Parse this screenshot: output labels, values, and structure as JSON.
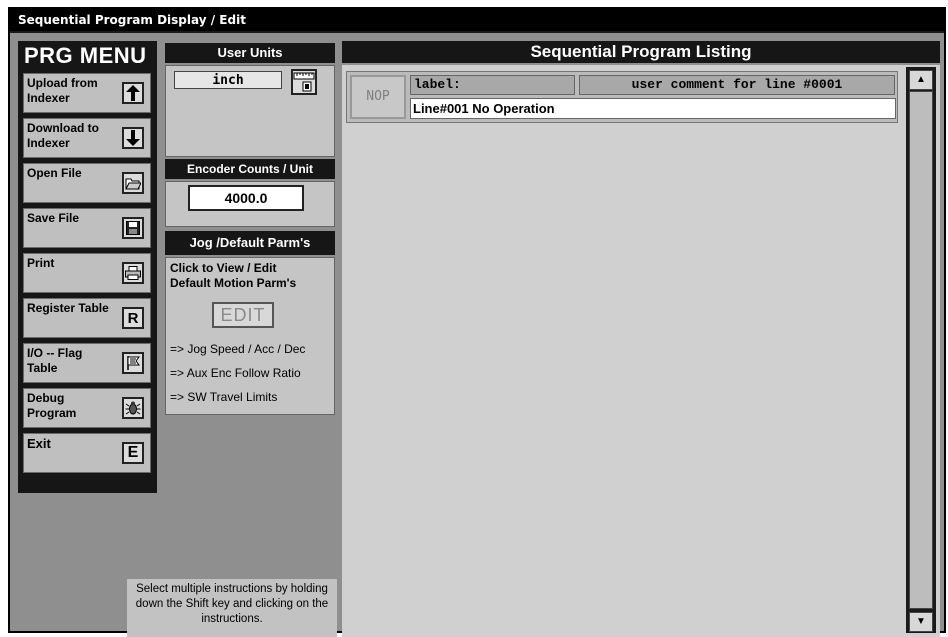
{
  "window": {
    "title": "Sequential Program Display / Edit"
  },
  "menu": {
    "title": "PRG MENU",
    "items": [
      {
        "label": "Upload from Indexer",
        "icon": "arrow-up-icon",
        "glyph": "🡅"
      },
      {
        "label": "Download to Indexer",
        "icon": "arrow-down-icon",
        "glyph": "🡇"
      },
      {
        "label": "Open File",
        "icon": "open-folder-icon",
        "glyph": ""
      },
      {
        "label": "Save File",
        "icon": "floppy-disk-icon",
        "glyph": ""
      },
      {
        "label": "Print",
        "icon": "printer-icon",
        "glyph": ""
      },
      {
        "label": "Register Table",
        "icon": "letter-r-icon",
        "glyph": "R"
      },
      {
        "label": "I/O -- Flag Table",
        "icon": "flag-icon",
        "glyph": ""
      },
      {
        "label": "Debug Program",
        "icon": "bug-icon",
        "glyph": ""
      },
      {
        "label": "Exit",
        "icon": "letter-e-icon",
        "glyph": "E"
      }
    ]
  },
  "user_units": {
    "header": "User Units",
    "value": "inch",
    "icon": "ruler-icon"
  },
  "encoder": {
    "header": "Encoder Counts / Unit",
    "value": "4000.0"
  },
  "jog": {
    "header": "Jog /Default Parm's",
    "line1": "Click to View / Edit",
    "line2": "Default Motion Parm's",
    "edit_label": "EDIT",
    "bullets": [
      "=> Jog Speed / Acc / Dec",
      "=> Aux Enc Follow Ratio",
      "=> SW Travel Limits"
    ]
  },
  "hint": "Select multiple instructions by holding down the Shift key and clicking on the instructions.",
  "listing": {
    "header": "Sequential Program Listing",
    "rows": [
      {
        "button": "NOP",
        "label": "label:",
        "comment": "user comment for line #0001",
        "text": "Line#001 No Operation"
      }
    ],
    "scroll_up": "▲",
    "scroll_down": "▼"
  }
}
